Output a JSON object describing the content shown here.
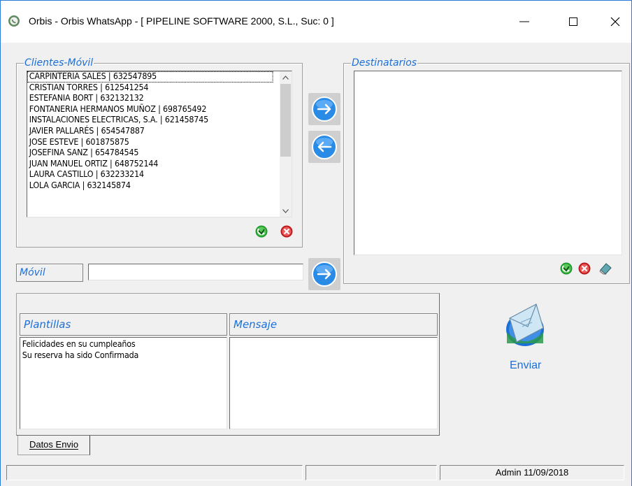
{
  "window": {
    "title": "Orbis - Orbis WhatsApp - [ PIPELINE SOFTWARE 2000, S.L.,  Suc: 0 ]",
    "minimize_label": "—",
    "maximize_label": "☐",
    "close_label": "✕"
  },
  "clientes": {
    "legend": "Clientes-Móvil",
    "items": [
      "CARPINTERIA SALES | 632547895",
      "CRISTIAN TORRES | 612541254",
      "ESTEFANIA BORT | 632132132",
      "FONTANERIA HERMANOS MUÑOZ | 698765492",
      "INSTALACIONES ELECTRICAS, S.A. | 621458745",
      "JAVIER PALLARÉS | 654547887",
      "JOSE ESTEVE | 601875875",
      "JOSEFINA SANZ | 654784545",
      "JUAN MANUEL ORTIZ | 648752144",
      "LAURA CASTILLO | 632233214",
      "LOLA GARCIA | 632145874"
    ]
  },
  "destinatarios": {
    "legend": "Destinatarios",
    "items": []
  },
  "movil": {
    "label": "Móvil",
    "value": ""
  },
  "plantillas": {
    "header": "Plantillas",
    "items": [
      "Felicidades en su cumpleaños",
      "Su reserva ha sido Confirmada"
    ]
  },
  "mensaje": {
    "header": "Mensaje",
    "value": ""
  },
  "tabs": {
    "datos_envio": "Datos Envio"
  },
  "send": {
    "label": "Enviar"
  },
  "status": {
    "cell1": "",
    "cell2": "",
    "cell3": "Admin 11/09/2018"
  },
  "colors": {
    "accent": "#1d6fd8",
    "arrow_blue": "#2a8be6",
    "check_green": "#1f9a2e",
    "cancel_red": "#d42a2a"
  }
}
